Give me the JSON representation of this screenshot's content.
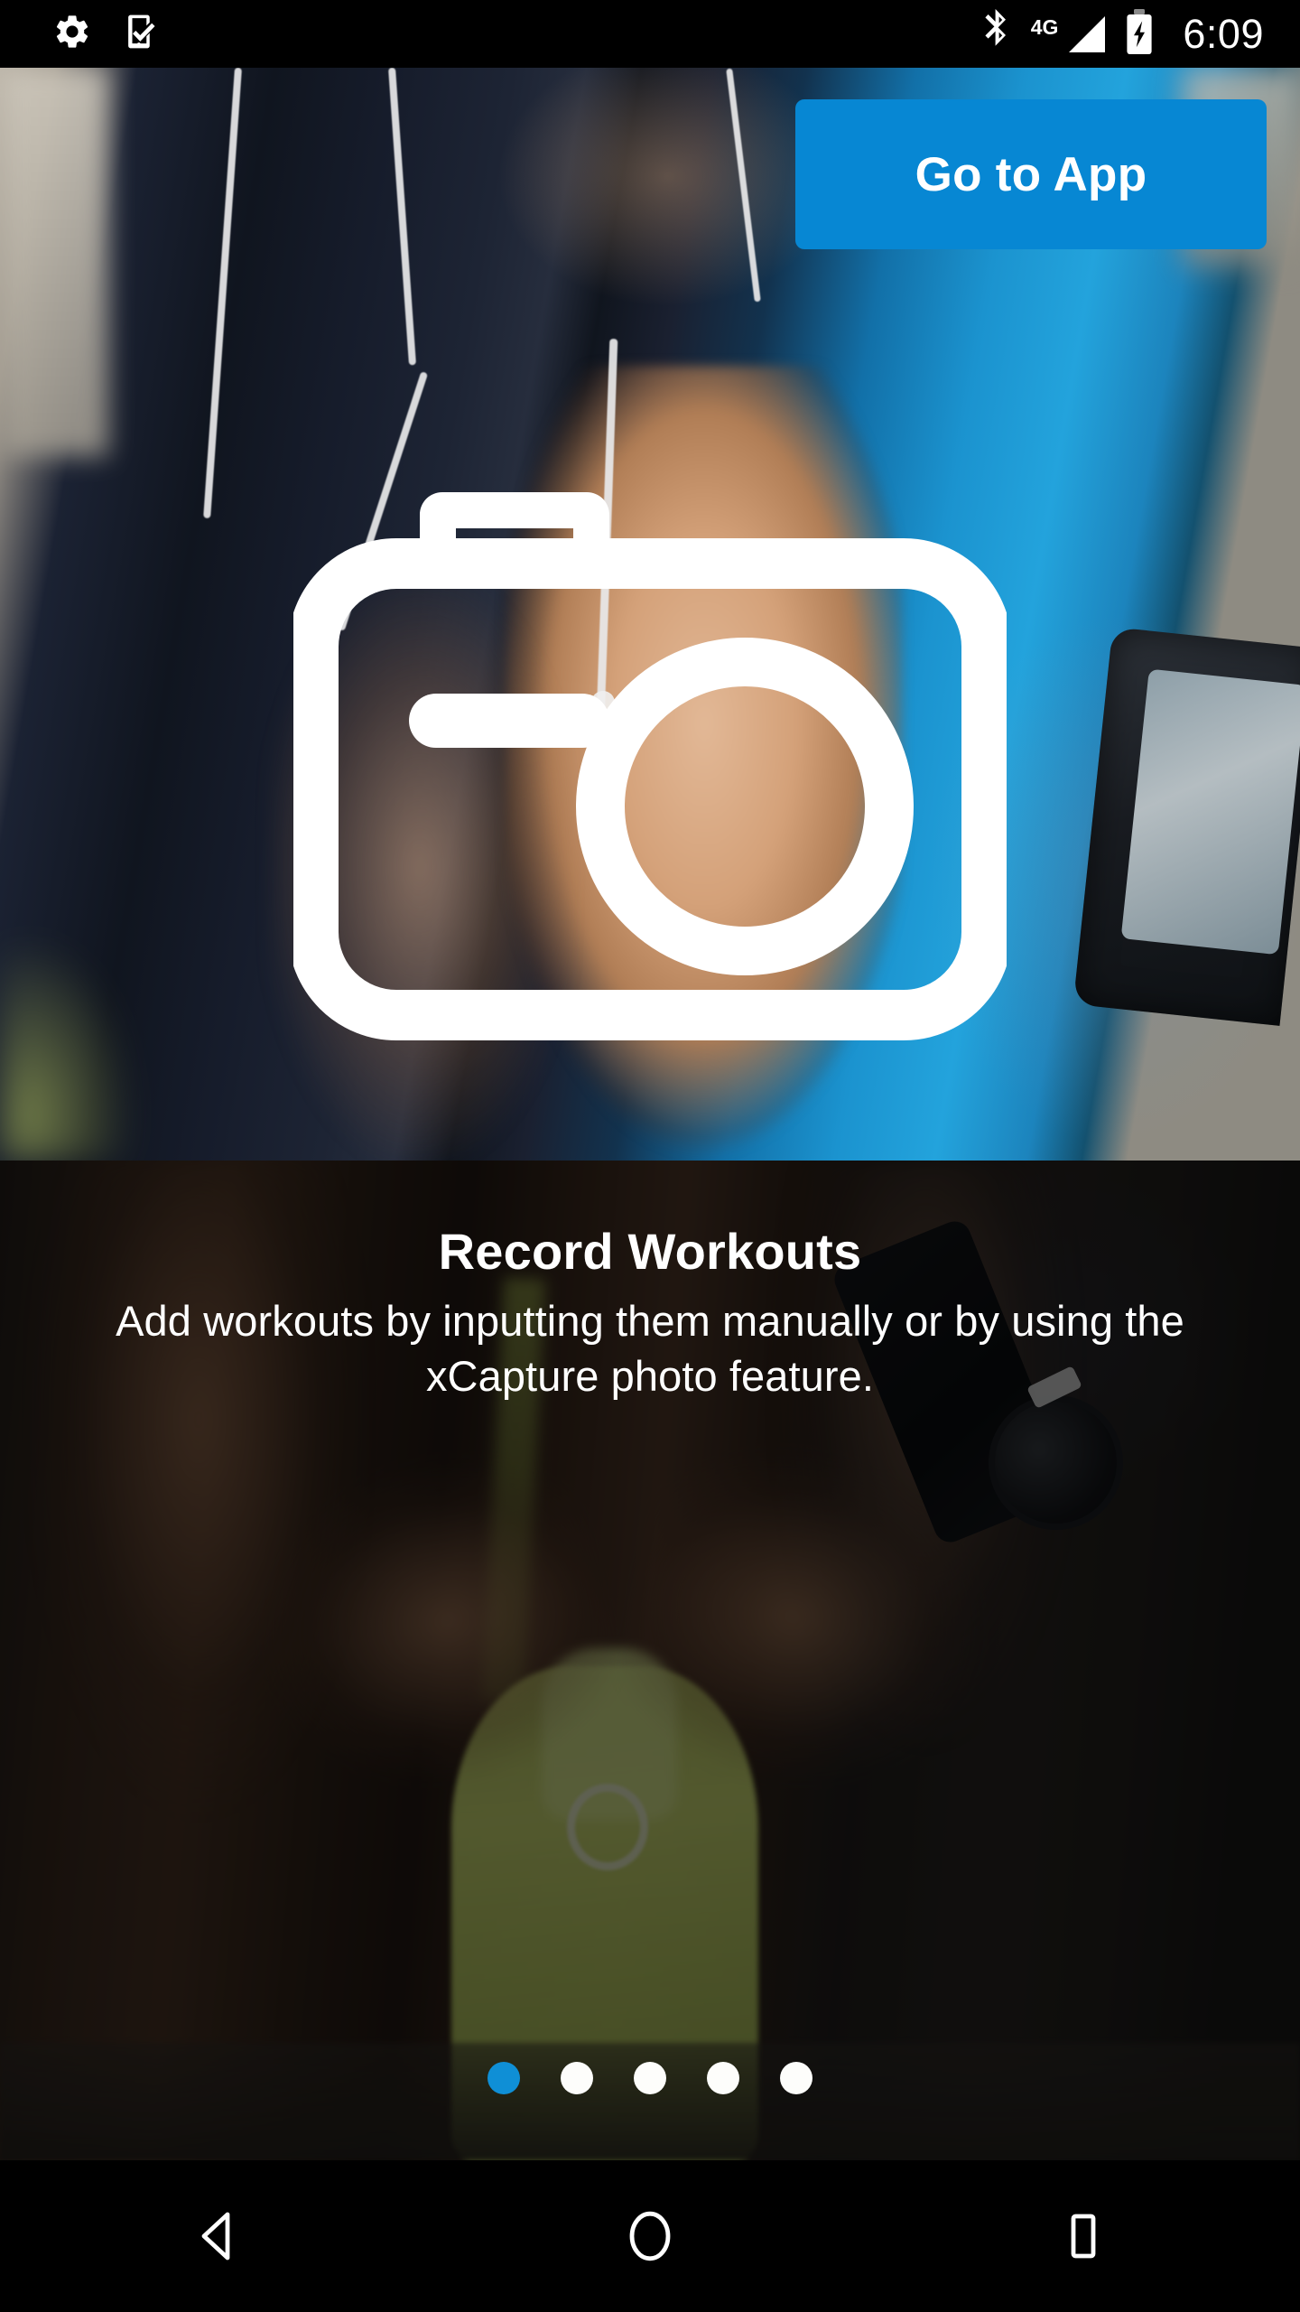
{
  "status_bar": {
    "time": "6:09",
    "network_type": "4G",
    "left_icons": [
      {
        "name": "settings-gear-icon",
        "label": "Settings"
      },
      {
        "name": "phone-check-icon",
        "label": "Device setup complete"
      }
    ],
    "right_icons": [
      {
        "name": "bluetooth-icon",
        "label": "Bluetooth on"
      },
      {
        "name": "signal-bars-icon",
        "label": "Cellular signal"
      },
      {
        "name": "battery-charging-icon",
        "label": "Battery charging"
      }
    ]
  },
  "hero": {
    "image_description": "Athlete in dark navy shirt with white earbuds crouching, blue athletic sleeve and phone armband",
    "overlay_icon": {
      "name": "camera-icon",
      "label": "Camera"
    },
    "go_to_app_button": {
      "label": "Go to App",
      "color": "#0787d3"
    }
  },
  "onboarding": {
    "title": "Record Workouts",
    "description": "Add workouts by inputting them manually or by using the xCapture photo feature.",
    "image_description": "Hands tying a neon lime running shoe with a black sport watch on the wrist"
  },
  "pagination": {
    "total": 5,
    "active_index": 0,
    "active_color": "#0f8fd6",
    "inactive_color": "#fdfdfb",
    "dots": [
      {
        "label": "Page 1"
      },
      {
        "label": "Page 2"
      },
      {
        "label": "Page 3"
      },
      {
        "label": "Page 4"
      },
      {
        "label": "Page 5"
      }
    ]
  },
  "navigation_bar": {
    "buttons": [
      {
        "name": "nav-back-button",
        "label": "Back"
      },
      {
        "name": "nav-home-button",
        "label": "Home"
      },
      {
        "name": "nav-recents-button",
        "label": "Recent apps"
      }
    ]
  }
}
